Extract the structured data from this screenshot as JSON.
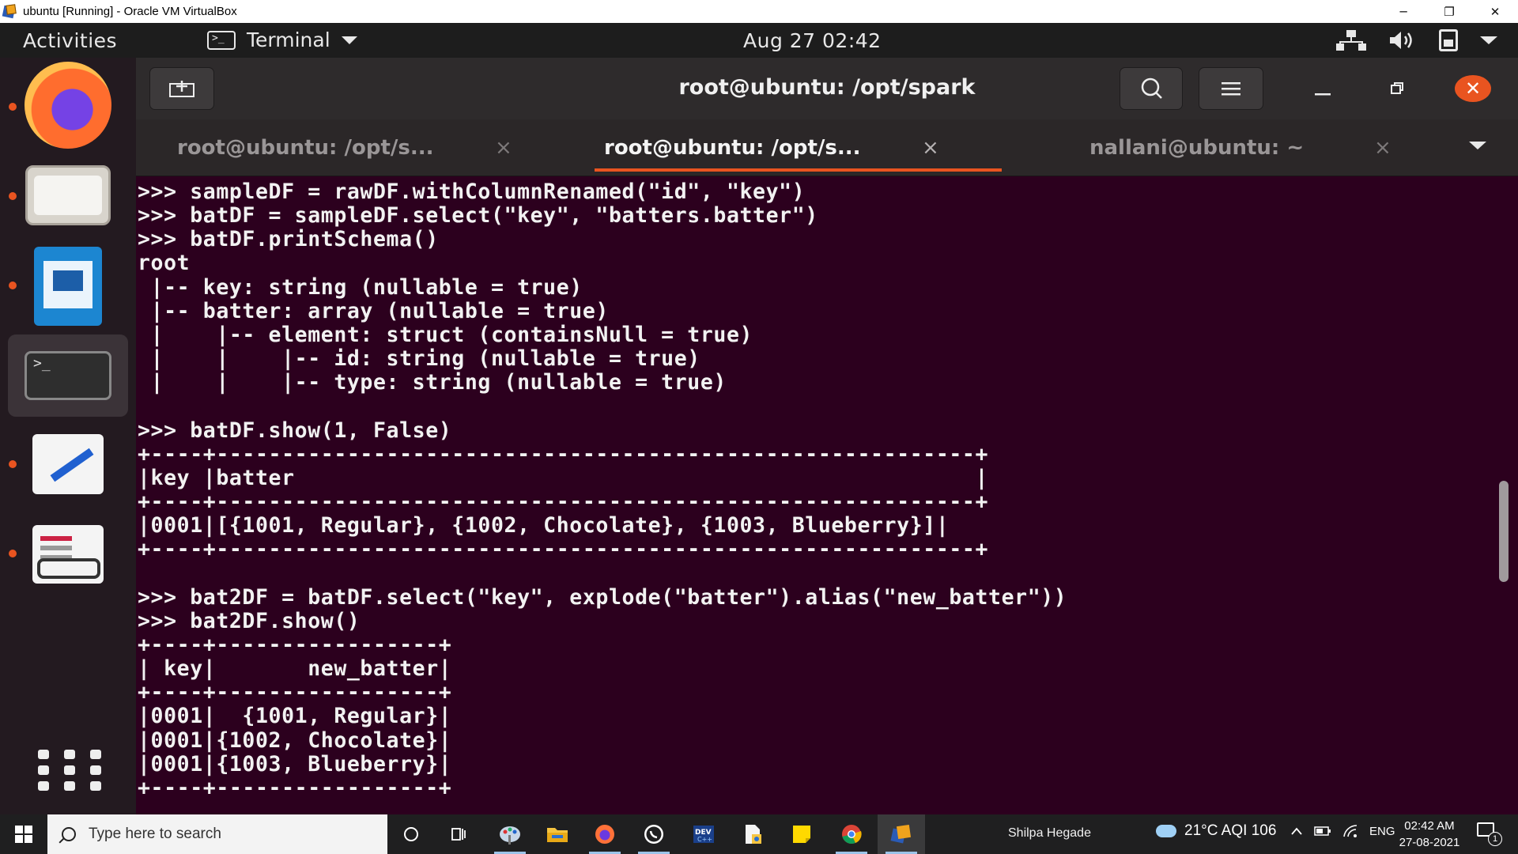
{
  "host_window": {
    "title": "ubuntu [Running] - Oracle VM VirtualBox",
    "minimize": "─",
    "restore": "❐",
    "close": "✕"
  },
  "topbar": {
    "activities": "Activities",
    "app_name": "Terminal",
    "clock": "Aug 27  02:42"
  },
  "dock": {
    "items": [
      "firefox",
      "files",
      "libreoffice-writer",
      "terminal",
      "text-editor",
      "document-viewer"
    ],
    "active": "terminal"
  },
  "terminal": {
    "title": "root@ubuntu: /opt/spark",
    "tabs": [
      {
        "label": "root@ubuntu: /opt/s...",
        "active": false
      },
      {
        "label": "root@ubuntu: /opt/s...",
        "active": true
      },
      {
        "label": "nallani@ubuntu: ~",
        "active": false
      }
    ],
    "tab_close": "×",
    "lines": [
      ">>> sampleDF = rawDF.withColumnRenamed(\"id\", \"key\")",
      ">>> batDF = sampleDF.select(\"key\", \"batters.batter\")",
      ">>> batDF.printSchema()",
      "root",
      " |-- key: string (nullable = true)",
      " |-- batter: array (nullable = true)",
      " |    |-- element: struct (containsNull = true)",
      " |    |    |-- id: string (nullable = true)",
      " |    |    |-- type: string (nullable = true)",
      "",
      ">>> batDF.show(1, False)",
      "+----+----------------------------------------------------------+",
      "|key |batter                                                    |",
      "+----+----------------------------------------------------------+",
      "|0001|[{1001, Regular}, {1002, Chocolate}, {1003, Blueberry}]|",
      "+----+----------------------------------------------------------+",
      "",
      ">>> bat2DF = batDF.select(\"key\", explode(\"batter\").alias(\"new_batter\"))",
      ">>> bat2DF.show()",
      "+----+-----------------+",
      "| key|       new_batter|",
      "+----+-----------------+",
      "|0001|  {1001, Regular}|",
      "|0001|{1002, Chocolate}|",
      "|0001|{1003, Blueberry}|",
      "+----+-----------------+"
    ]
  },
  "taskbar": {
    "search_placeholder": "Type here to search",
    "user": "Shilpa Hegade",
    "weather": "21°C  AQI 106",
    "language": "ENG",
    "time": "02:42 AM",
    "date": "27-08-2021",
    "notification_count": "1"
  },
  "colors": {
    "terminal_bg": "#2c001e",
    "accent": "#e95420",
    "headerbar": "#2e2b2c"
  }
}
